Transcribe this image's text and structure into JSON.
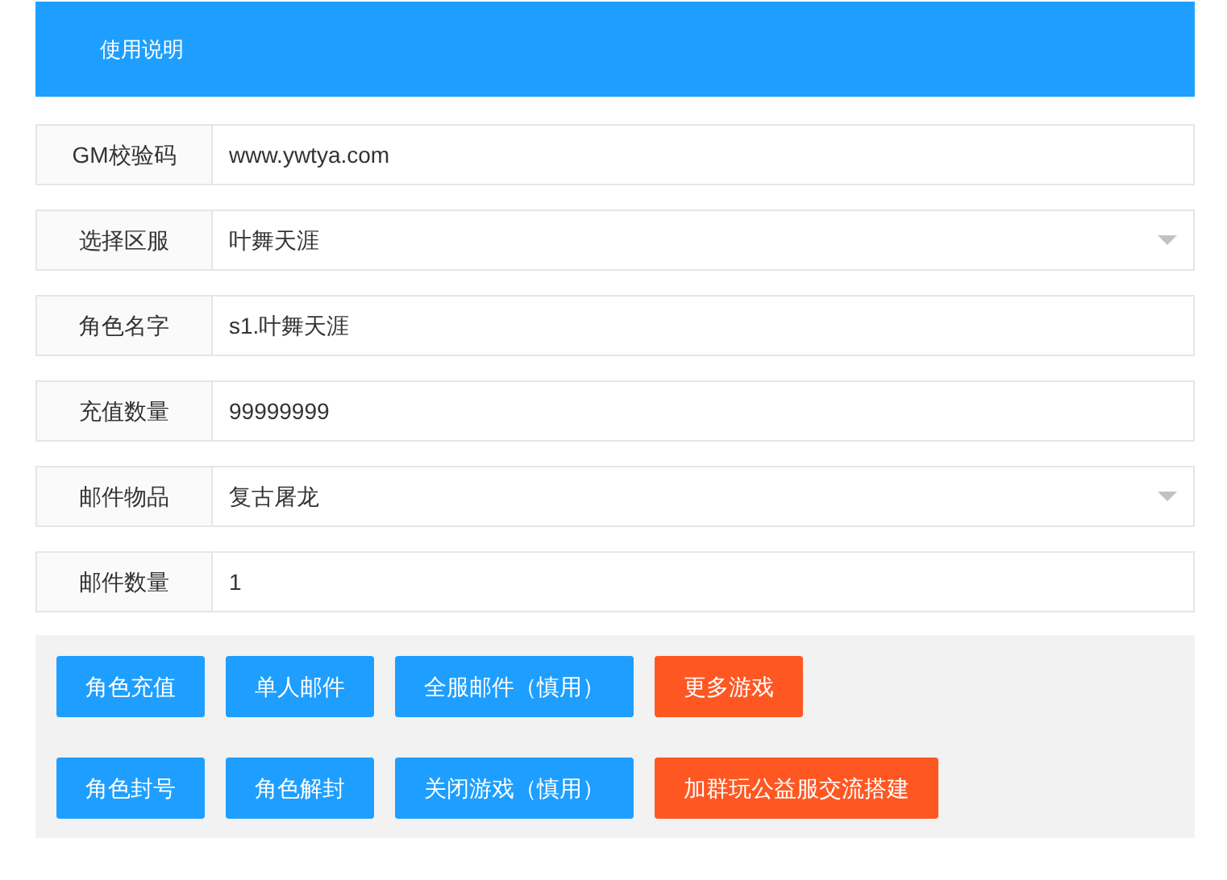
{
  "header": {
    "title": "使用说明"
  },
  "fields": [
    {
      "label": "GM校验码",
      "kind": "input",
      "value": "www.ywtya.com"
    },
    {
      "label": "选择区服",
      "kind": "select",
      "value": "叶舞天涯"
    },
    {
      "label": "角色名字",
      "kind": "input",
      "value": "s1.叶舞天涯"
    },
    {
      "label": "充值数量",
      "kind": "input",
      "value": "99999999"
    },
    {
      "label": "邮件物品",
      "kind": "select",
      "value": "复古屠龙"
    },
    {
      "label": "邮件数量",
      "kind": "input",
      "value": "1"
    }
  ],
  "button_rows": [
    [
      {
        "label": "角色充值",
        "color": "#1e9fff"
      },
      {
        "label": "单人邮件",
        "color": "#1e9fff"
      },
      {
        "label": "全服邮件（慎用）",
        "color": "#1e9fff"
      },
      {
        "label": "更多游戏",
        "color": "#ff5722"
      }
    ],
    [
      {
        "label": "角色封号",
        "color": "#1e9fff"
      },
      {
        "label": "角色解封",
        "color": "#1e9fff"
      },
      {
        "label": "关闭游戏（慎用）",
        "color": "#1e9fff"
      },
      {
        "label": "加群玩公益服交流搭建",
        "color": "#ff5722"
      }
    ]
  ]
}
